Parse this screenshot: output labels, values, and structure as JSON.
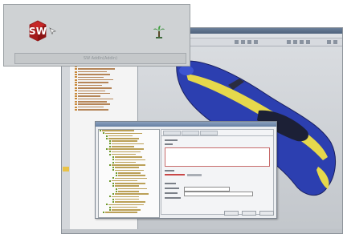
{
  "status_field": {
    "text": "SW AddIn(Addin)"
  },
  "logo": {
    "text": "SW"
  },
  "icons": {
    "logo": "solidworks-logo",
    "pointer": "mouse-pointer-icon",
    "tree": "palm-tree-icon"
  },
  "colors": {
    "logo_red": "#c62727",
    "model_blue": "#2c3fb0",
    "model_yellow": "#e6d84c",
    "model_dark": "#1c2036"
  }
}
